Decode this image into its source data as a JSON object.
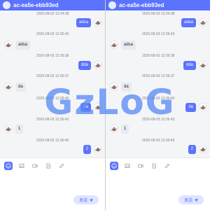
{
  "chat": {
    "title": "ac-ea5e-ebb93ed",
    "messages": [
      {
        "time": "2025-08-03 12:34:38",
        "text": "adsa",
        "from": "me"
      },
      {
        "time": "2025-08-03 12:36:43",
        "text": "adsa",
        "from": "other"
      },
      {
        "time": "2025-08-03 12:36:38",
        "text": "dda",
        "from": "me"
      },
      {
        "time": "2025-08-03 12:36:37",
        "text": "da",
        "from": "other"
      },
      {
        "time": "2025-08-03 12:36:40",
        "text": "da",
        "from": "me"
      },
      {
        "time": "2025-08-03 12:36:43",
        "text": "1",
        "from": "other"
      },
      {
        "time": "2025-08-03 12:36:45",
        "text": "2",
        "from": "me"
      }
    ],
    "toolbar_icons": [
      "emoji-icon",
      "image-icon",
      "video-icon",
      "file-icon",
      "link-icon"
    ],
    "send_label": "发送",
    "input_placeholder": ""
  },
  "watermark": "GzLoG",
  "colors": {
    "accent": "#5b73ff",
    "accent_light": "#dfe4ff",
    "other_bubble": "#e8eaef",
    "background": "#f4f5f7",
    "watermark": "#5b8cf7"
  }
}
